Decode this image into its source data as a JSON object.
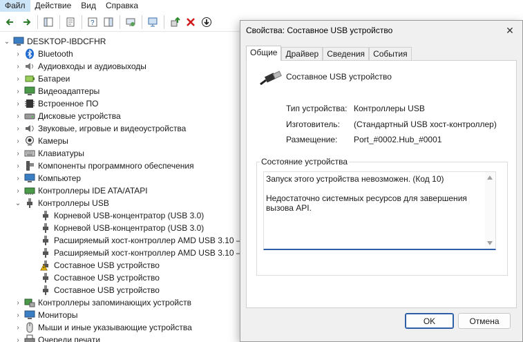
{
  "menu": [
    {
      "label": "Файл"
    },
    {
      "label": "Действие"
    },
    {
      "label": "Вид"
    },
    {
      "label": "Справка"
    }
  ],
  "tree": {
    "root": "DESKTOP-IBDCFHR",
    "categories": [
      {
        "label": "Bluetooth"
      },
      {
        "label": "Аудиовходы и аудиовыходы"
      },
      {
        "label": "Батареи"
      },
      {
        "label": "Видеоадаптеры"
      },
      {
        "label": "Встроенное ПО"
      },
      {
        "label": "Дисковые устройства"
      },
      {
        "label": "Звуковые, игровые и видеоустройства"
      },
      {
        "label": "Камеры"
      },
      {
        "label": "Клавиатуры"
      },
      {
        "label": "Компоненты программного обеспечения"
      },
      {
        "label": "Компьютер"
      },
      {
        "label": "Контроллеры IDE ATA/ATAPI"
      },
      {
        "label": "Контроллеры USB"
      }
    ],
    "usb_children": [
      {
        "label": "Корневой USB-концентратор (USB 3.0)"
      },
      {
        "label": "Корневой USB-концентратор (USB 3.0)"
      },
      {
        "label": "Расширяемый хост-контроллер AMD USB 3.10 —"
      },
      {
        "label": "Расширяемый хост-контроллер AMD USB 3.10 —"
      },
      {
        "label": "Составное USB устройство"
      },
      {
        "label": "Составное USB устройство"
      },
      {
        "label": "Составное USB устройство"
      }
    ],
    "after": [
      {
        "label": "Контроллеры запоминающих устройств"
      },
      {
        "label": "Мониторы"
      },
      {
        "label": "Мыши и иные указывающие устройства"
      },
      {
        "label": "Очереди печати"
      }
    ]
  },
  "dialog": {
    "title": "Свойства: Составное USB устройство",
    "tabs": [
      "Общие",
      "Драйвер",
      "Сведения",
      "События"
    ],
    "device_name": "Составное USB устройство",
    "props": [
      {
        "label": "Тип устройства:",
        "value": "Контроллеры USB"
      },
      {
        "label": "Изготовитель:",
        "value": "(Стандартный USB хост-контроллер)"
      },
      {
        "label": "Размещение:",
        "value": "Port_#0002.Hub_#0001"
      }
    ],
    "status_title": "Состояние устройства",
    "status_text": "Запуск этого устройства невозможен. (Код 10)\n\nНедостаточно системных ресурсов для завершения вызова API.",
    "ok": "OK",
    "cancel": "Отмена"
  }
}
